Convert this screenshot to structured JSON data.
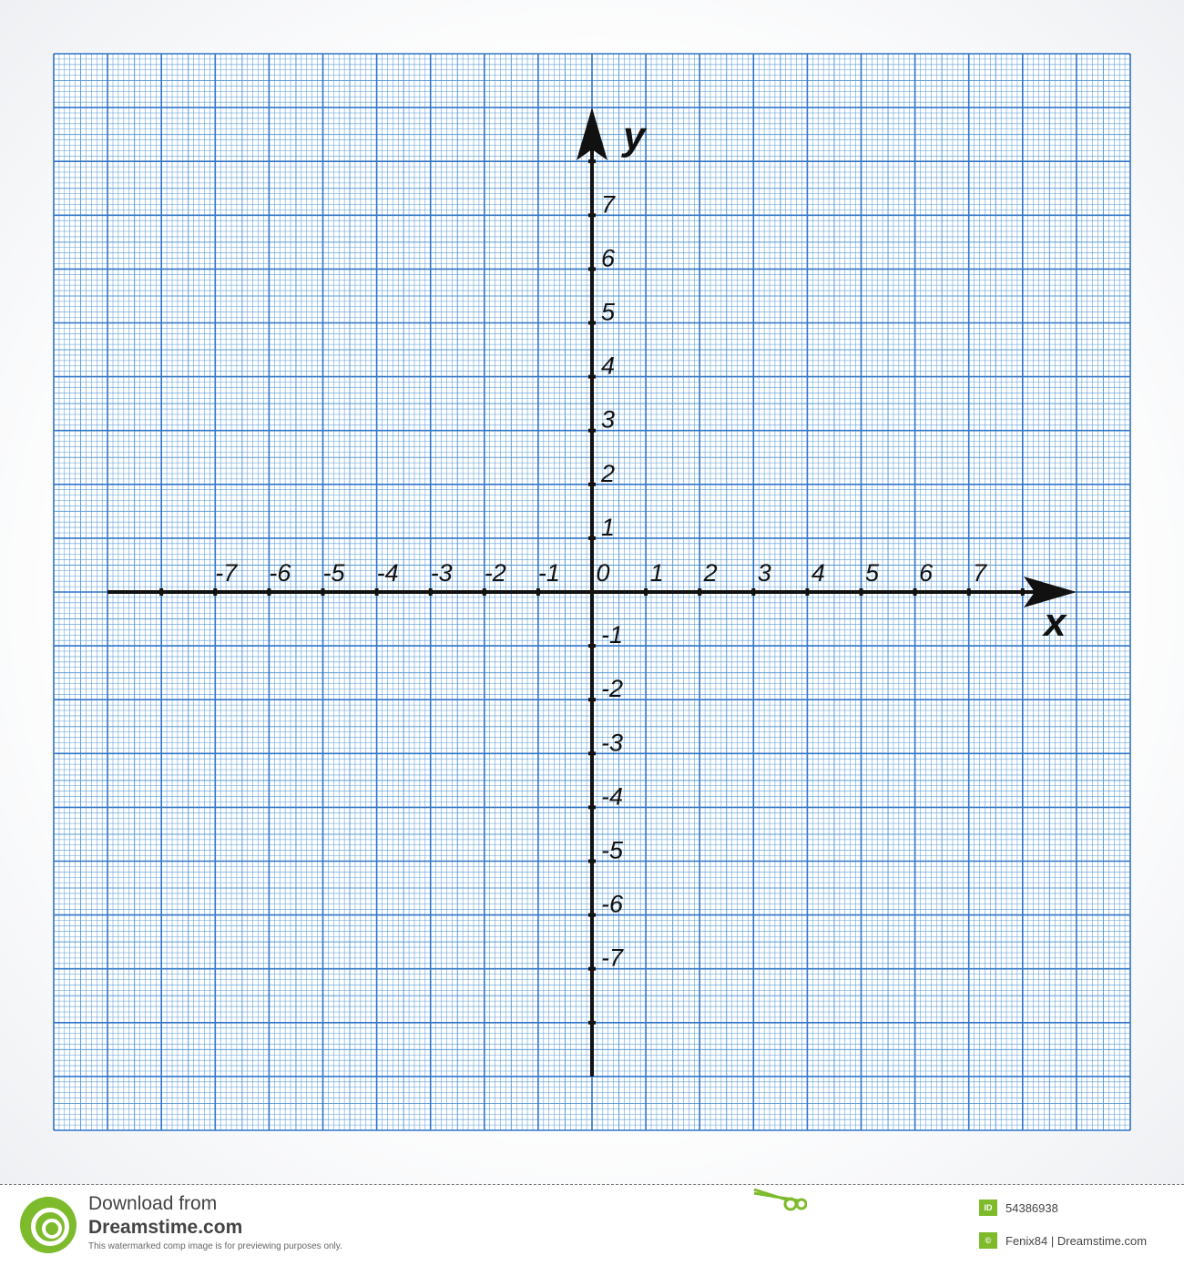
{
  "diagram": {
    "x_axis_label": "x",
    "y_axis_label": "y",
    "x_ticks": [
      -7,
      -6,
      -5,
      -4,
      -3,
      -2,
      -1,
      0,
      1,
      2,
      3,
      4,
      5,
      6,
      7
    ],
    "y_ticks": [
      7,
      6,
      5,
      4,
      3,
      2,
      1,
      -1,
      -2,
      -3,
      -4,
      -5,
      -6,
      -7
    ],
    "x_range": [
      -9,
      9
    ],
    "y_range": [
      -9,
      9
    ],
    "grid_minor_per_unit": 10,
    "colors": {
      "grid_minor": "#5b9bd5",
      "grid_major": "#2f75c7",
      "axis": "#111111",
      "paper": "#ffffff"
    }
  },
  "footer": {
    "download_text": "Download from",
    "site_name": "Dreamstime.com",
    "preview_note": "This watermarked comp image is for previewing purposes only.",
    "id_badge": "ID",
    "image_id": "54386938",
    "copyright_badge": "©",
    "credit": "Fenix84 | Dreamstime.com",
    "logo_icon": "dreamstime-logo-icon",
    "scissors_icon": "scissors-icon",
    "brand_color": "#7dbb2d"
  }
}
